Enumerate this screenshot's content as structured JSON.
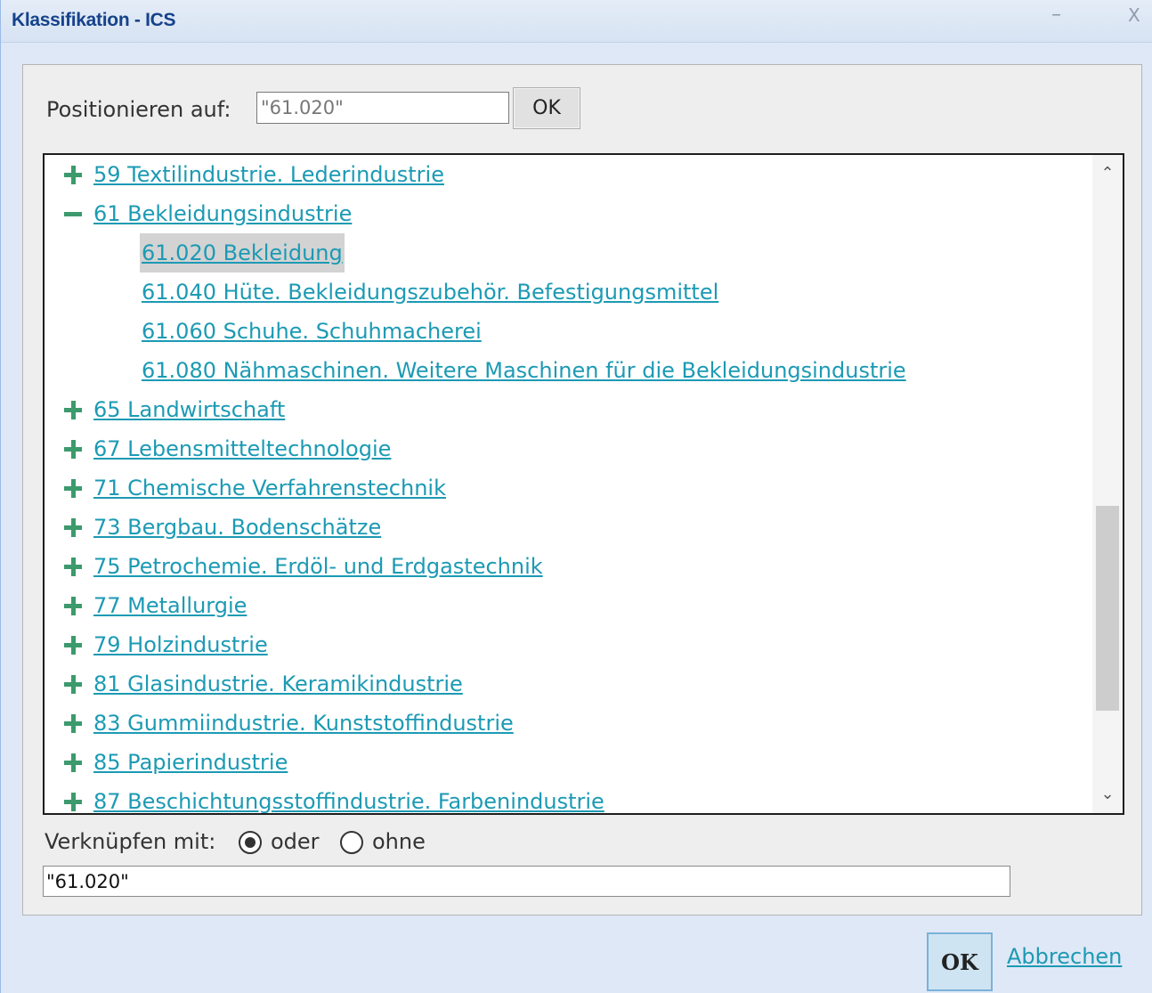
{
  "window": {
    "title": "Klassifikation - ICS",
    "minimize": "–",
    "close": "X"
  },
  "position": {
    "label": "Positionieren auf:",
    "value": "\"61.020\"",
    "ok_label": "OK"
  },
  "tree": {
    "items": [
      {
        "toggle": "plus",
        "label": "59 Textilindustrie. Lederindustrie",
        "level": 0
      },
      {
        "toggle": "minus",
        "label": "61 Bekleidungsindustrie",
        "level": 0
      },
      {
        "toggle": "none",
        "label": "61.020 Bekleidung",
        "level": 1,
        "selected": true
      },
      {
        "toggle": "none",
        "label": "61.040 Hüte. Bekleidungszubehör. Befestigungsmittel",
        "level": 1
      },
      {
        "toggle": "none",
        "label": "61.060 Schuhe. Schuhmacherei",
        "level": 1
      },
      {
        "toggle": "none",
        "label": "61.080 Nähmaschinen. Weitere Maschinen für die Bekleidungsindustrie",
        "level": 1
      },
      {
        "toggle": "plus",
        "label": "65 Landwirtschaft",
        "level": 0
      },
      {
        "toggle": "plus",
        "label": "67 Lebensmitteltechnologie",
        "level": 0
      },
      {
        "toggle": "plus",
        "label": "71 Chemische Verfahrenstechnik",
        "level": 0
      },
      {
        "toggle": "plus",
        "label": "73 Bergbau. Bodenschätze",
        "level": 0
      },
      {
        "toggle": "plus",
        "label": "75 Petrochemie. Erdöl- und Erdgastechnik",
        "level": 0
      },
      {
        "toggle": "plus",
        "label": "77 Metallurgie",
        "level": 0
      },
      {
        "toggle": "plus",
        "label": "79 Holzindustrie",
        "level": 0
      },
      {
        "toggle": "plus",
        "label": "81 Glasindustrie. Keramikindustrie",
        "level": 0
      },
      {
        "toggle": "plus",
        "label": "83 Gummiindustrie. Kunststoffindustrie",
        "level": 0
      },
      {
        "toggle": "plus",
        "label": "85 Papierindustrie",
        "level": 0
      },
      {
        "toggle": "plus",
        "label": "87 Beschichtungsstoffindustrie. Farbenindustrie",
        "level": 0
      }
    ],
    "scroll_position": 0.62
  },
  "link": {
    "label": "Verknüpfen mit:",
    "options": [
      {
        "label": "oder",
        "checked": true
      },
      {
        "label": "ohne",
        "checked": false
      }
    ]
  },
  "result_value": "\"61.020\"",
  "footer": {
    "ok_label": "OK",
    "cancel_label": "Abbrechen"
  },
  "colors": {
    "link": "#1c9ab4",
    "toggle": "#3c9a6c",
    "title": "#15428b"
  }
}
